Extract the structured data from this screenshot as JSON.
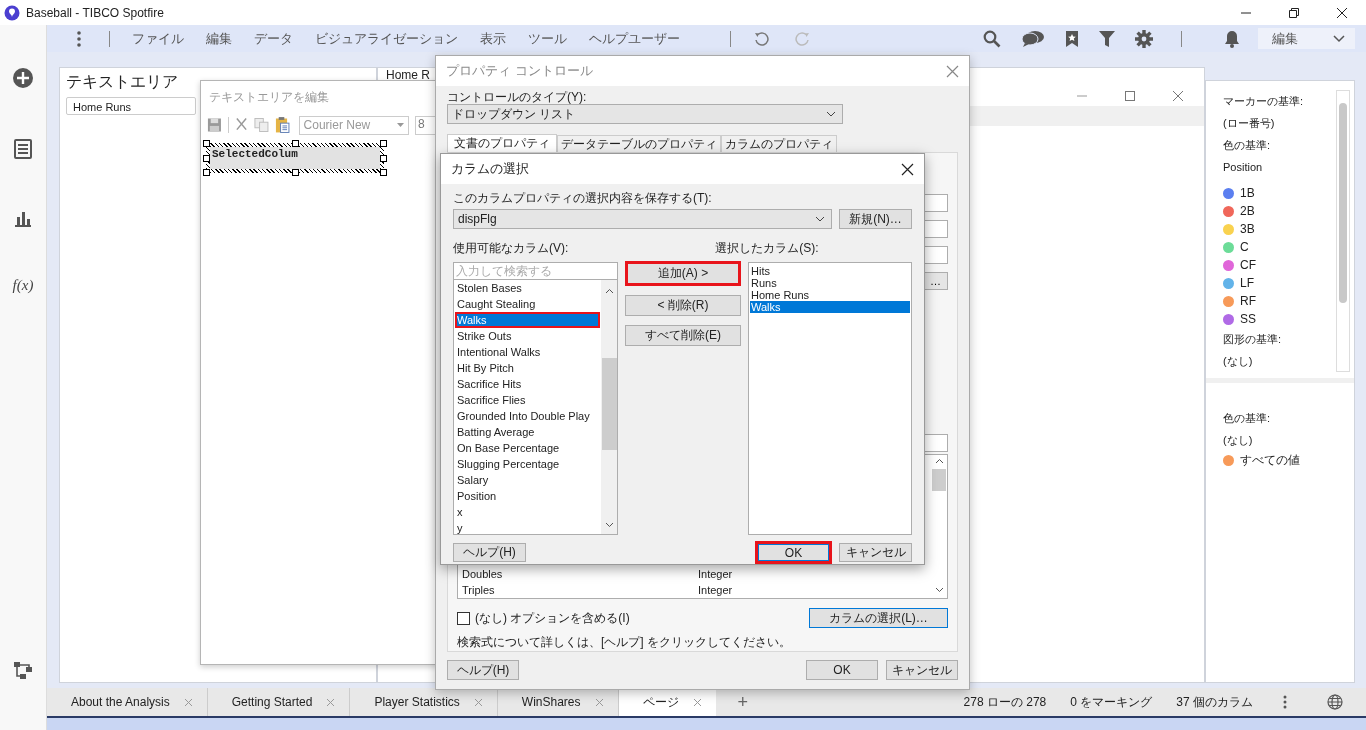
{
  "window": {
    "title": "Baseball - TIBCO Spotfire"
  },
  "menu": {
    "items": [
      "ファイル",
      "編集",
      "データ",
      "ビジュアライゼーション",
      "表示",
      "ツール",
      "ヘルプ",
      "ユーザー"
    ],
    "mode": "編集"
  },
  "rail": {
    "formula": "f(x)"
  },
  "text_area_panel": {
    "title": "テキストエリア",
    "dropdown": "Home Runs"
  },
  "visualization_panel": {
    "title": "Home R"
  },
  "legend": {
    "marker_heading": "マーカーの基準:",
    "marker_value": "(ロー番号)",
    "color_heading": "色の基準:",
    "color_value": "Position",
    "items": [
      {
        "label": "1B",
        "color": "#5b7ff0"
      },
      {
        "label": "2B",
        "color": "#f0675a"
      },
      {
        "label": "3B",
        "color": "#f9d24f"
      },
      {
        "label": "C",
        "color": "#6cdc98"
      },
      {
        "label": "CF",
        "color": "#e066d9"
      },
      {
        "label": "LF",
        "color": "#62b3e9"
      },
      {
        "label": "RF",
        "color": "#f79a59"
      },
      {
        "label": "SS",
        "color": "#b06ae6"
      }
    ],
    "shape_heading": "図形の基準:",
    "shape_value": "(なし)",
    "second_color_heading": "色の基準:",
    "second_color_value": "(なし)",
    "second_items": [
      {
        "label": "すべての値",
        "color": "#f79a59"
      }
    ]
  },
  "editor_window": {
    "title": "テキストエリアを編集",
    "font": "Courier New",
    "font_size": "8",
    "content": "SelectedColum"
  },
  "property_dialog": {
    "title": "プロパティ コントロール",
    "type_label": "コントロールのタイプ(Y):",
    "type_value": "ドロップダウン リスト",
    "tabs": [
      {
        "label": "文書のプロパティ",
        "selected": true
      },
      {
        "label": "データテーブルのプロパティ",
        "selected": false
      },
      {
        "label": "カラムのプロパティ",
        "selected": false
      }
    ],
    "more_button": "…",
    "column_rows": [
      {
        "name": "Doubles",
        "type": "Integer"
      },
      {
        "name": "Triples",
        "type": "Integer"
      }
    ],
    "include_none": {
      "label": "(なし) オプションを含める(I)",
      "checked": false
    },
    "select_columns_button": "カラムの選択(L)…",
    "help_text": "検索式について詳しくは、[ヘルプ] をクリックしてください。",
    "buttons": [
      "ヘルプ(H)",
      "OK",
      "キャンセル"
    ]
  },
  "column_dialog": {
    "title": "カラムの選択",
    "save_label": "このカラムプロパティの選択内容を保存する(T):",
    "save_value": "dispFlg",
    "new_button": "新規(N)…",
    "available_label": "使用可能なカラム(V):",
    "search_placeholder": "入力して検索する",
    "available": [
      {
        "label": "Stolen Bases",
        "selected": false,
        "highlighted": false
      },
      {
        "label": "Caught Stealing",
        "selected": false,
        "highlighted": false
      },
      {
        "label": "Walks",
        "selected": true,
        "highlighted": true
      },
      {
        "label": "Strike Outs",
        "selected": false,
        "highlighted": false
      },
      {
        "label": "Intentional Walks",
        "selected": false,
        "highlighted": false
      },
      {
        "label": "Hit By Pitch",
        "selected": false,
        "highlighted": false
      },
      {
        "label": "Sacrifice Hits",
        "selected": false,
        "highlighted": false
      },
      {
        "label": "Sacrifice Flies",
        "selected": false,
        "highlighted": false
      },
      {
        "label": "Grounded Into Double Play",
        "selected": false,
        "highlighted": false
      },
      {
        "label": "Batting Average",
        "selected": false,
        "highlighted": false
      },
      {
        "label": "On Base Percentage",
        "selected": false,
        "highlighted": false
      },
      {
        "label": "Slugging Percentage",
        "selected": false,
        "highlighted": false
      },
      {
        "label": "Salary",
        "selected": false,
        "highlighted": false
      },
      {
        "label": "Position",
        "selected": false,
        "highlighted": false
      },
      {
        "label": "x",
        "selected": false,
        "highlighted": false
      },
      {
        "label": "y",
        "selected": false,
        "highlighted": false
      }
    ],
    "actions": [
      {
        "label": "追加(A) >",
        "highlighted": true
      },
      {
        "label": "< 削除(R)",
        "highlighted": false
      },
      {
        "label": "すべて削除(E)",
        "highlighted": false
      }
    ],
    "selected_label": "選択したカラム(S):",
    "selected_columns": [
      {
        "label": "Hits",
        "selected": false
      },
      {
        "label": "Runs",
        "selected": false
      },
      {
        "label": "Home Runs",
        "selected": false
      },
      {
        "label": "Walks",
        "selected": true
      }
    ],
    "buttons": [
      {
        "label": "ヘルプ(H)",
        "highlighted": false
      },
      {
        "label": "OK",
        "highlighted": true
      },
      {
        "label": "キャンセル",
        "highlighted": false
      }
    ]
  },
  "page_tabs": [
    {
      "label": "About the Analysis",
      "selected": false
    },
    {
      "label": "Getting Started",
      "selected": false
    },
    {
      "label": "Player Statistics",
      "selected": false
    },
    {
      "label": "WinShares",
      "selected": false
    },
    {
      "label": "ページ",
      "selected": true
    }
  ],
  "add_tab": "+",
  "status": [
    "278 ローの 278",
    "0 をマーキング",
    "37 個のカラム"
  ]
}
